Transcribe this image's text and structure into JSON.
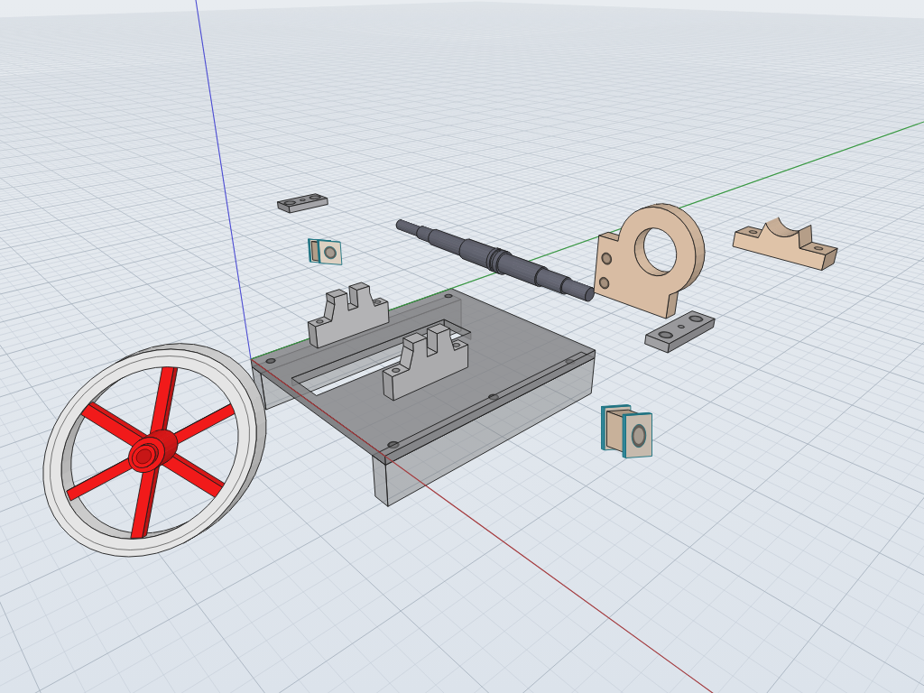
{
  "parts": [
    {
      "kind": "base-plate"
    },
    {
      "kind": "pedestal"
    },
    {
      "kind": "pedestal"
    },
    {
      "kind": "clamp-bar"
    },
    {
      "kind": "bushing"
    },
    {
      "kind": "shaft"
    },
    {
      "kind": "saddle"
    },
    {
      "kind": "bracket"
    },
    {
      "kind": "clamp-bar"
    },
    {
      "kind": "bushing"
    },
    {
      "kind": "flywheel"
    }
  ]
}
